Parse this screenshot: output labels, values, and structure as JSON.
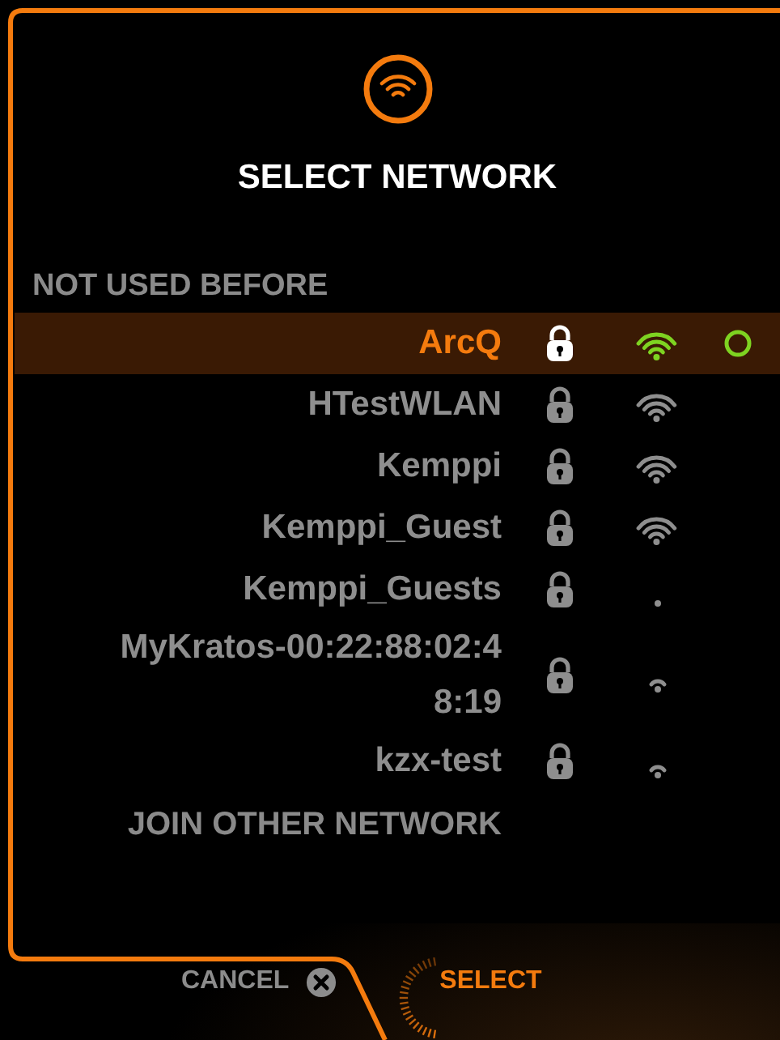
{
  "header": {
    "title": "SELECT NETWORK"
  },
  "section": "NOT USED BEFORE",
  "networks": [
    {
      "name": "ArcQ",
      "secured": true,
      "kind": "strong",
      "selected": true
    },
    {
      "name": "HTestWLAN",
      "secured": true,
      "kind": "strong",
      "selected": false
    },
    {
      "name": "Kemppi",
      "secured": true,
      "kind": "strong",
      "selected": false
    },
    {
      "name": "Kemppi_Guest",
      "secured": true,
      "kind": "strong",
      "selected": false
    },
    {
      "name": "Kemppi_Guests",
      "secured": true,
      "kind": "none",
      "selected": false
    },
    {
      "name": "MyKratos-00:22:88:02:48:19",
      "secured": true,
      "kind": "weak",
      "selected": false
    },
    {
      "name": "kzx-test",
      "secured": true,
      "kind": "weak",
      "selected": false
    }
  ],
  "join": "JOIN OTHER NETWORK",
  "buttons": [
    {
      "kind": "cancel",
      "label": "CANCEL"
    },
    {
      "kind": "select",
      "label": "SELECT"
    }
  ]
}
